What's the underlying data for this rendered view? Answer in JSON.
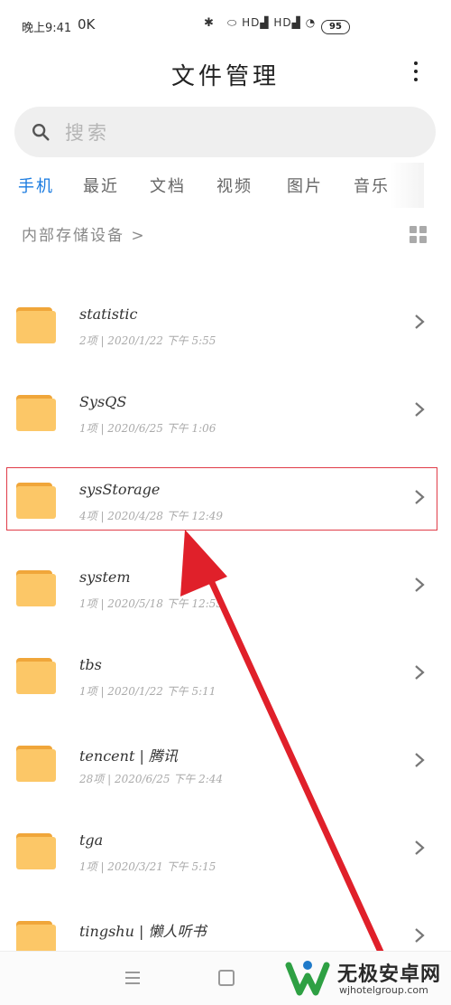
{
  "status_bar": {
    "time": "晚上9:41",
    "extra": "0K",
    "network": "HD",
    "battery": "95"
  },
  "header": {
    "title": "文件管理"
  },
  "search": {
    "placeholder": "搜索"
  },
  "tabs": [
    {
      "label": "手机",
      "active": true
    },
    {
      "label": "最近",
      "active": false
    },
    {
      "label": "文档",
      "active": false
    },
    {
      "label": "视频",
      "active": false
    },
    {
      "label": "图片",
      "active": false
    },
    {
      "label": "音乐",
      "active": false
    }
  ],
  "breadcrumb": {
    "label": "内部存储设备 >"
  },
  "files": [
    {
      "name": "statistic",
      "meta": "2项 | 2020/1/22 下午 5:55"
    },
    {
      "name": "SysQS",
      "meta": "1项 | 2020/6/25 下午 1:06"
    },
    {
      "name": "sysStorage",
      "meta": "4项 | 2020/4/28 下午 12:49",
      "highlighted": true
    },
    {
      "name": "system",
      "meta": "1项 | 2020/5/18 下午 12:55"
    },
    {
      "name": "tbs",
      "meta": "1项 | 2020/1/22 下午 5:11"
    },
    {
      "name": "tencent | 腾讯",
      "meta": "28项 | 2020/6/25 下午 2:44"
    },
    {
      "name": "tga",
      "meta": "1项 | 2020/3/21 下午 5:15"
    },
    {
      "name": "tingshu | 懒人听书",
      "meta": ""
    }
  ],
  "watermark": {
    "title": "无极安卓网",
    "subtitle": "wjhotelgroup.com"
  },
  "colors": {
    "accent": "#1a7be0",
    "folder": "#fcc767",
    "annotation": "#e03c48"
  }
}
